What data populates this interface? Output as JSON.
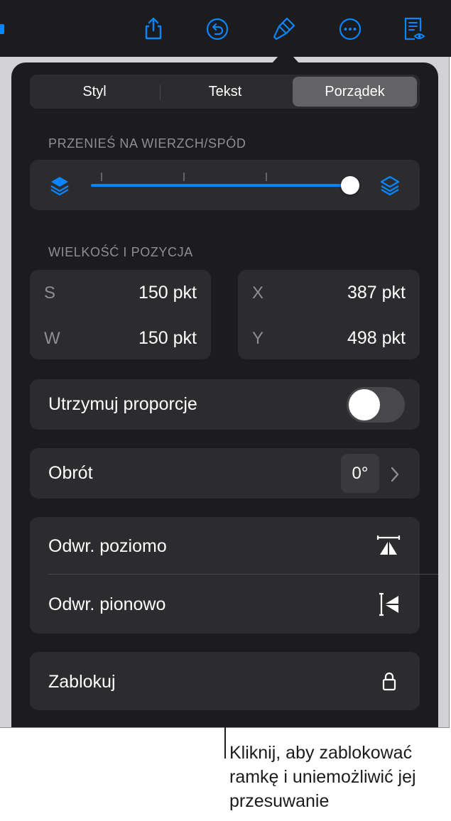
{
  "toolbar": {
    "icons": [
      "share-icon",
      "undo-icon",
      "format-paintbrush-icon",
      "more-icon",
      "reader-view-icon"
    ],
    "accent": "#0a84ff"
  },
  "tabs": [
    {
      "label": "Styl",
      "active": false
    },
    {
      "label": "Tekst",
      "active": false
    },
    {
      "label": "Porządek",
      "active": true
    }
  ],
  "arrange": {
    "section_label": "PRZENIEŚ NA WIERZCH/SPÓD",
    "slider_value": 1.0
  },
  "size_position": {
    "section_label": "WIELKOŚĆ I POZYCJA",
    "fields": [
      {
        "label": "S",
        "value": "150 pkt"
      },
      {
        "label": "W",
        "value": "150 pkt"
      },
      {
        "label": "X",
        "value": "387 pkt"
      },
      {
        "label": "Y",
        "value": "498 pkt"
      }
    ]
  },
  "constrain": {
    "label": "Utrzymuj proporcje",
    "on": false
  },
  "rotate": {
    "label": "Obrót",
    "value": "0°"
  },
  "flip": {
    "horizontal": "Odwr. poziomo",
    "vertical": "Odwr. pionowo"
  },
  "lock": {
    "label": "Zablokuj"
  },
  "callout": {
    "text": "Kliknij, aby zablokować ramkę i uniemożliwić jej przesuwanie"
  }
}
